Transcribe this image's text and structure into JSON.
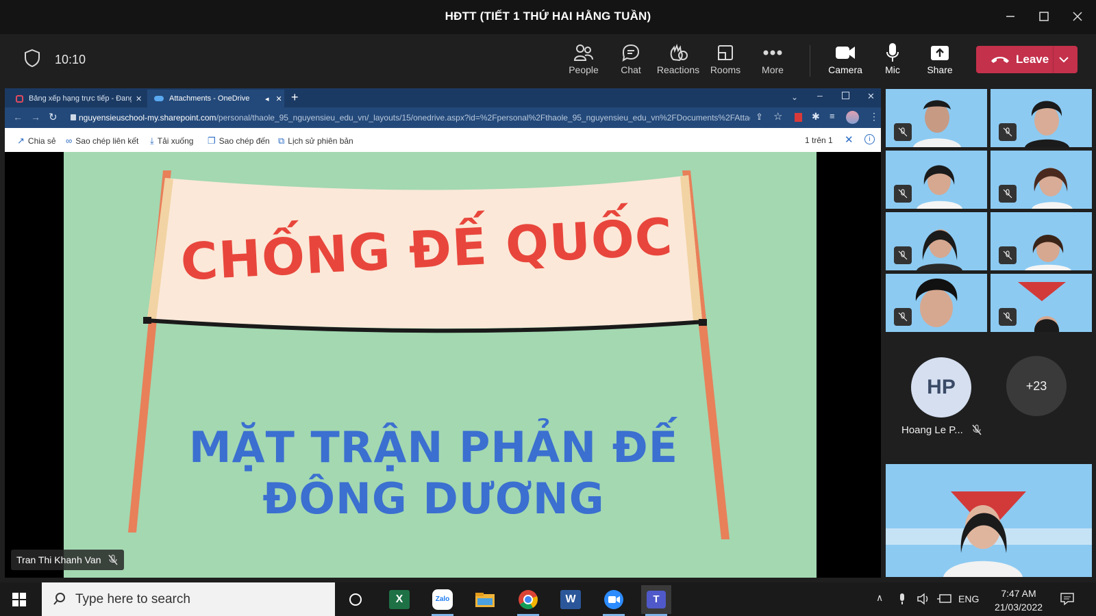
{
  "window": {
    "title": "HĐTT (TIẾT 1 THỨ HAI HẰNG TUẦN)"
  },
  "meeting": {
    "timer": "10:10"
  },
  "toolbar": {
    "people": "People",
    "chat": "Chat",
    "reactions": "Reactions",
    "rooms": "Rooms",
    "more": "More",
    "camera": "Camera",
    "mic": "Mic",
    "share": "Share",
    "leave": "Leave"
  },
  "browser": {
    "tabs": [
      {
        "label": "Bảng xếp hạng trực tiếp - Đang c"
      },
      {
        "label": "Attachments - OneDrive"
      }
    ],
    "url_domain": "nguyensieuschool-my.sharepoint.com",
    "url_path": "/personal/thaole_95_nguyensieu_edu_vn/_layouts/15/onedrive.aspx?id=%2Fpersonal%2Fthaole_95_nguyensieu_edu_vn%2FDocuments%2FAttachm...",
    "onedrive_actions": [
      "Chia sẻ",
      "Sao chép liên kết",
      "Tải xuống",
      "Sao chép đến",
      "Lịch sử phiên bản"
    ],
    "page_count": "1 trên 1"
  },
  "slide": {
    "banner_text": "CHỐNG ĐẾ QUỐC",
    "line1": "MẶT TRẬN PHẢN ĐẾ",
    "line2": "ĐÔNG DƯƠNG"
  },
  "presenter": {
    "name": "Tran Thi Khanh Van"
  },
  "participants": {
    "hp_initials": "HP",
    "hp_name": "Hoang Le P...",
    "more_count": "+23"
  },
  "taskbar": {
    "search_placeholder": "Type here to search",
    "language": "ENG",
    "time": "7:47 AM",
    "date": "21/03/2022"
  },
  "colors": {
    "leave_red": "#c4314b",
    "browser_blue": "#23497a",
    "slide_green": "#a3d8b1",
    "banner_red": "#e8463c",
    "slide_blue": "#3b6fd0"
  }
}
